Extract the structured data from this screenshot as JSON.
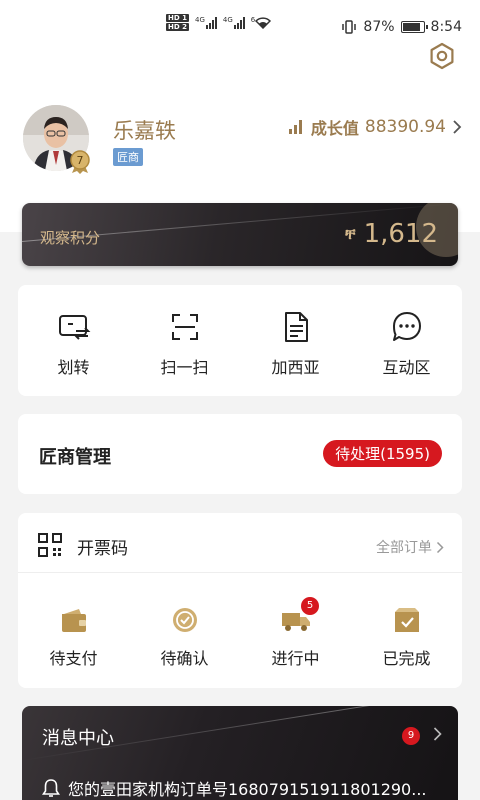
{
  "status_bar": {
    "hd1": "HD 1",
    "hd2": "HD 2",
    "net1": "4G",
    "net2": "4G",
    "wifi": "6",
    "battery": "87%",
    "battery_level": 0.87,
    "time": "8:54"
  },
  "profile": {
    "name": "乐嘉轶",
    "role": "匠商",
    "level": "7",
    "growth_label": "成长值",
    "growth_value": "88390.94"
  },
  "points": {
    "label": "观察积分",
    "coin_symbol": "ቸ",
    "value": "1,612"
  },
  "quick_actions": [
    {
      "label": "划转",
      "icon": "transfer-card-icon"
    },
    {
      "label": "扫一扫",
      "icon": "scan-icon"
    },
    {
      "label": "加西亚",
      "icon": "document-icon"
    },
    {
      "label": "互动区",
      "icon": "chat-bubble-icon"
    }
  ],
  "management": {
    "title": "匠商管理",
    "pending": "待处理(1595)"
  },
  "orders": {
    "title": "开票码",
    "all_orders": "全部订单",
    "items": [
      {
        "label": "待支付",
        "icon": "wallet-icon"
      },
      {
        "label": "待确认",
        "icon": "confirm-icon"
      },
      {
        "label": "进行中",
        "icon": "truck-icon",
        "badge": "5"
      },
      {
        "label": "已完成",
        "icon": "box-check-icon"
      }
    ]
  },
  "messages": {
    "title": "消息中心",
    "count": "9",
    "latest": "您的壹田家机构订单号16807915191180129​0..."
  },
  "colors": {
    "gold": "#9a7b4f",
    "points_gold": "#d4b88c",
    "red": "#d6181f",
    "role_badge": "#6b9bd1"
  }
}
